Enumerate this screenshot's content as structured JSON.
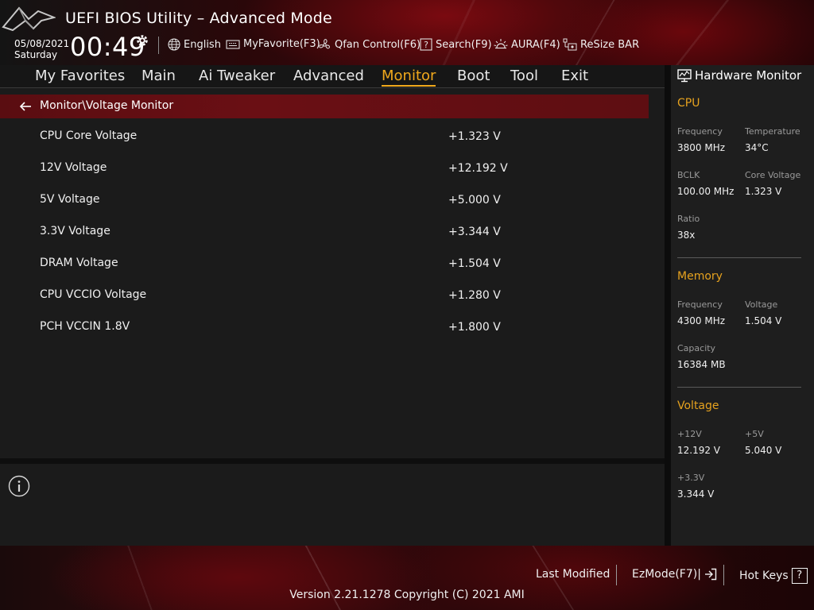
{
  "header": {
    "title": "UEFI BIOS Utility – Advanced Mode",
    "date": "05/08/2021",
    "day": "Saturday",
    "time": "00:49",
    "tools": {
      "language": "English",
      "myfavorite": "MyFavorite(F3)",
      "qfan": "Qfan Control(F6)",
      "search": "Search(F9)",
      "aura": "AURA(F4)",
      "resize_bar": "ReSize BAR"
    }
  },
  "tabs": [
    "My Favorites",
    "Main",
    "Ai Tweaker",
    "Advanced",
    "Monitor",
    "Boot",
    "Tool",
    "Exit"
  ],
  "active_tab": "Monitor",
  "breadcrumb": "Monitor\\Voltage Monitor",
  "voltages": [
    {
      "label": "CPU Core Voltage",
      "value": "+1.323 V"
    },
    {
      "label": "12V Voltage",
      "value": "+12.192 V"
    },
    {
      "label": "5V Voltage",
      "value": "+5.000 V"
    },
    {
      "label": "3.3V Voltage",
      "value": "+3.344 V"
    },
    {
      "label": "DRAM Voltage",
      "value": "+1.504 V"
    },
    {
      "label": "CPU VCCIO Voltage",
      "value": "+1.280 V"
    },
    {
      "label": "PCH VCCIN 1.8V",
      "value": "+1.800 V"
    }
  ],
  "hardware_monitor": {
    "title": "Hardware Monitor",
    "cpu": {
      "heading": "CPU",
      "frequency_label": "Frequency",
      "frequency": "3800 MHz",
      "temperature_label": "Temperature",
      "temperature": "34°C",
      "bclk_label": "BCLK",
      "bclk": "100.00 MHz",
      "core_voltage_label": "Core Voltage",
      "core_voltage": "1.323 V",
      "ratio_label": "Ratio",
      "ratio": "38x"
    },
    "memory": {
      "heading": "Memory",
      "frequency_label": "Frequency",
      "frequency": "4300 MHz",
      "voltage_label": "Voltage",
      "voltage": "1.504 V",
      "capacity_label": "Capacity",
      "capacity": "16384 MB"
    },
    "voltage": {
      "heading": "Voltage",
      "v12_label": "+12V",
      "v12": "12.192 V",
      "v5_label": "+5V",
      "v5": "5.040 V",
      "v33_label": "+3.3V",
      "v33": "3.344 V"
    }
  },
  "footer": {
    "last_modified": "Last Modified",
    "ezmode": "EzMode(F7)|",
    "hotkeys": "Hot Keys",
    "hotkeys_key": "?",
    "version": "Version 2.21.1278 Copyright (C) 2021 AMI"
  },
  "colors": {
    "accent": "#f0a81c",
    "breadcrumb_bg": "#6a0f14",
    "panel_bg": "#1b1b1b"
  },
  "icons": [
    "rog-logo-icon",
    "gear-icon",
    "globe-icon",
    "keyboard-icon",
    "fan-icon",
    "search-box-icon",
    "aura-icon",
    "resize-bar-icon",
    "back-arrow-icon",
    "info-icon",
    "monitor-icon",
    "exit-arrow-icon"
  ]
}
